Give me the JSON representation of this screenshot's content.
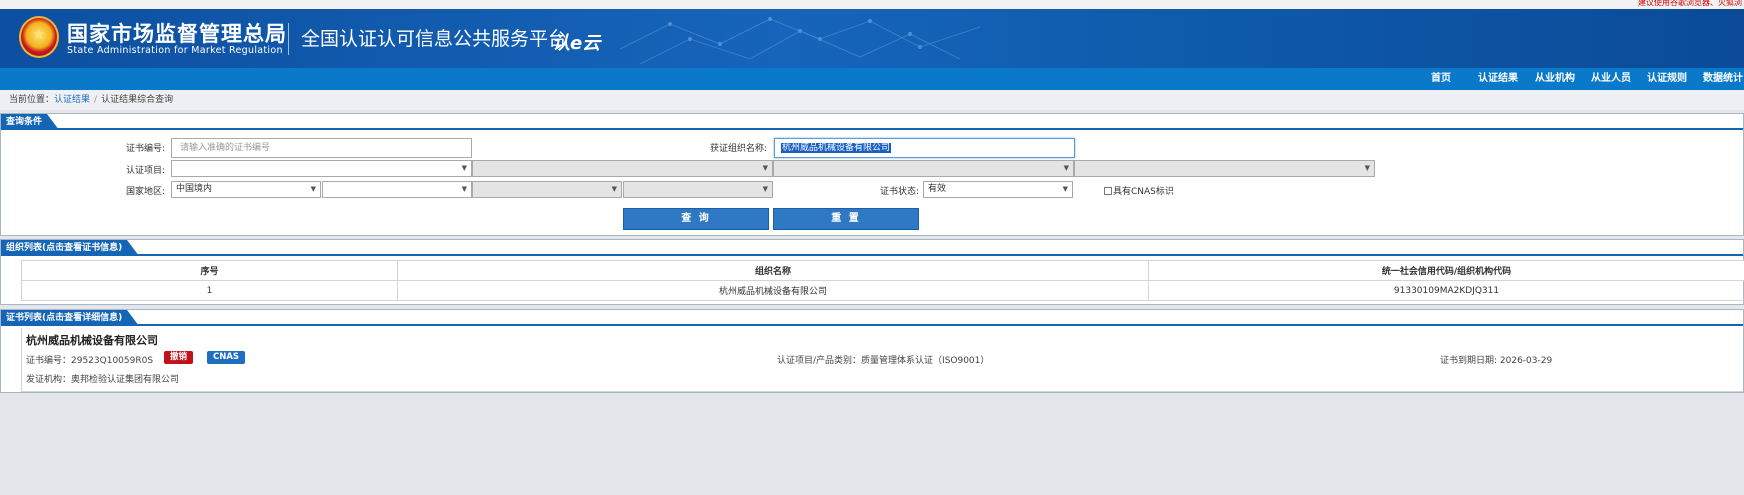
{
  "topstrip": {
    "notice": "建议使用谷歌浏览器、火狐浏"
  },
  "header": {
    "org_cn": "国家市场监督管理总局",
    "org_en": "State Administration  for  Market Regulation",
    "platform": "全国认证认可信息公共服务平台",
    "logo_text": "认e云"
  },
  "nav": {
    "items": [
      "首页",
      "认证结果",
      "从业机构",
      "从业人员",
      "认证规则",
      "数据统计"
    ]
  },
  "breadcrumb": {
    "prefix": "当前位置：",
    "link": "认证结果",
    "current": "认证结果综合查询"
  },
  "query": {
    "title": "查询条件",
    "cert_no_label": "证书编号:",
    "cert_no_placeholder": "请输入准确的证书编号",
    "org_name_label": "获证组织名称:",
    "org_name_value": "杭州威品机械设备有限公司",
    "project_label": "认证项目:",
    "region_label": "国家地区:",
    "region_value": "中国境内",
    "status_label": "证书状态:",
    "status_value": "有效",
    "cnas_label": "具有CNAS标识",
    "search_button": "查 询",
    "reset_button": "重 置"
  },
  "org_list": {
    "title": "组织列表(点击查看证书信息)",
    "columns": [
      "序号",
      "组织名称",
      "统一社会信用代码/组织机构代码"
    ],
    "rows": [
      [
        "1",
        "杭州威品机械设备有限公司",
        "91330109MA2KDJQ311"
      ]
    ]
  },
  "cert_list": {
    "title": "证书列表(点击查看详细信息)",
    "org_name": "杭州威品机械设备有限公司",
    "cert_no": "证书编号：29523Q10059R0S",
    "badge_revoked": "撤销",
    "badge_cnas": "CNAS",
    "project": "认证项目/产品类别：质量管理体系认证（ISO9001）",
    "expiry": "证书到期日期: 2026-03-29",
    "issuer": "发证机构：奥邦检验认证集团有限公司"
  },
  "colors": {
    "primary": "#1565b6",
    "nav": "#0b79c9",
    "revoked": "#c0121a",
    "cnas": "#1e6fc2"
  }
}
